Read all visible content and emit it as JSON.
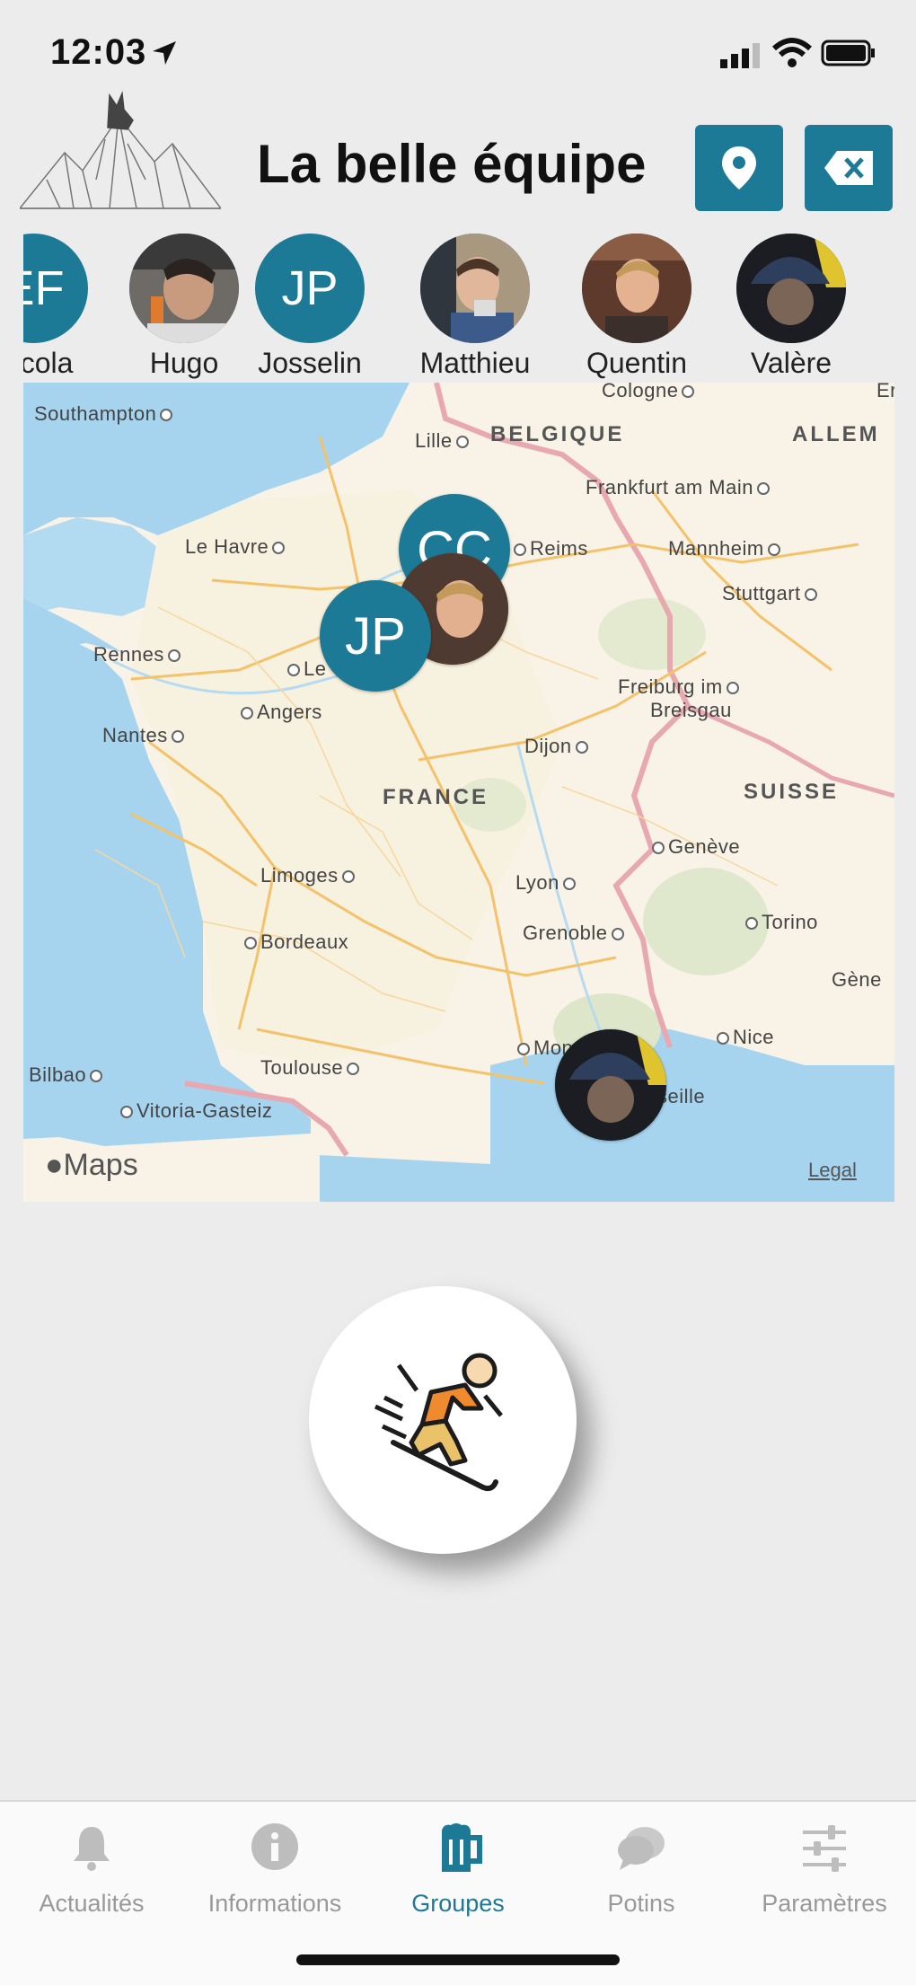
{
  "status_bar": {
    "time": "12:03"
  },
  "header": {
    "title": "La belle équipe",
    "logo_icon": "wolf-mountain-logo",
    "location_button_icon": "location-pin-icon",
    "delete_button_icon": "backspace-icon",
    "accent_color": "#1d7a96"
  },
  "members": [
    {
      "initials": "EF",
      "name": "Nicola",
      "has_photo": false
    },
    {
      "initials": "",
      "name": "Hugo",
      "has_photo": true
    },
    {
      "initials": "JP",
      "name": "Josselin",
      "has_photo": false
    },
    {
      "initials": "",
      "name": "Matthieu",
      "has_photo": true
    },
    {
      "initials": "",
      "name": "Quentin",
      "has_photo": true
    },
    {
      "initials": "",
      "name": "Valère",
      "has_photo": true
    }
  ],
  "map": {
    "cities": [
      "Southampton",
      "Lille",
      "Cologne",
      "Frankfurt am Main",
      "Le Havre",
      "Reims",
      "Mannheim",
      "Stuttgart",
      "Rennes",
      "Le",
      "Angers",
      "Freiburg im",
      "Breisgau",
      "Nantes",
      "Dijon",
      "Genève",
      "Limoges",
      "Lyon",
      "Torino",
      "Bordeaux",
      "Grenoble",
      "Gène",
      "Mon",
      "Nice",
      "Bilbao",
      "Toulouse",
      "seille",
      "Vitoria-Gasteiz",
      "Er"
    ],
    "countries": [
      "BELGIQUE",
      "ALLEM",
      "FRANCE",
      "SUISSE"
    ],
    "pins": [
      "CC",
      "JP"
    ],
    "brand": "Maps",
    "legal": "Legal"
  },
  "ski_button": {
    "icon": "skier-icon"
  },
  "tabs": [
    {
      "label": "Actualités",
      "icon": "bell-icon",
      "active": false
    },
    {
      "label": "Informations",
      "icon": "info-icon",
      "active": false
    },
    {
      "label": "Groupes",
      "icon": "beer-mug-icon",
      "active": true
    },
    {
      "label": "Potins",
      "icon": "chat-bubbles-icon",
      "active": false
    },
    {
      "label": "Paramètres",
      "icon": "sliders-icon",
      "active": false
    }
  ]
}
